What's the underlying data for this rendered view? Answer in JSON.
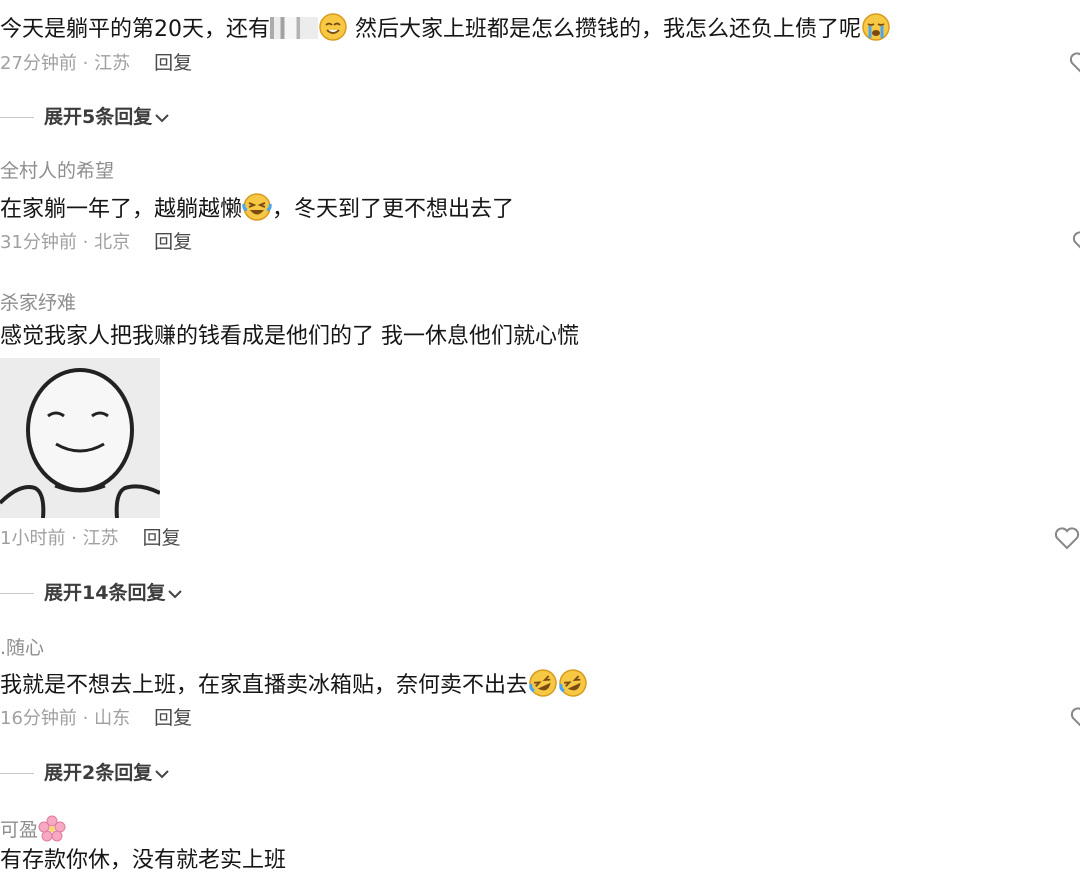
{
  "comments": [
    {
      "text_a": "今天是躺平的第20天，还有",
      "text_b": " 然后大家上班都是怎么攒钱的，我怎么还负上债了呢",
      "time": "27分钟前 · 江苏",
      "reply": "回复",
      "expand": "展开5条回复"
    },
    {
      "user": "全村人的希望",
      "text_a": "在家躺一年了，越躺越懒",
      "text_b": "，冬天到了更不想出去了",
      "time": "31分钟前 · 北京",
      "reply": "回复"
    },
    {
      "user": "杀家纾难",
      "text": "感觉我家人把我赚的钱看成是他们的了   我一休息他们就心慌",
      "time": "1小时前 · 江苏",
      "reply": "回复",
      "expand": "展开14条回复"
    },
    {
      "user": ".随心",
      "text": "我就是不想去上班，在家直播卖冰箱贴，奈何卖不出去",
      "time": "16分钟前 · 山东",
      "reply": "回复",
      "expand": "展开2条回复"
    },
    {
      "user": "可盈",
      "text": "有存款你休，没有就老实上班"
    }
  ],
  "icons": {
    "like": "heart-icon",
    "expand": "chevron-down-icon",
    "emoji_smile": "smile-emoji",
    "emoji_cry": "crying-emoji",
    "emoji_laugh": "laughing-tears-emoji",
    "emoji_rofl": "rofl-emoji",
    "emoji_blossom": "cherry-blossom-emoji"
  },
  "colors": {
    "meta": "#a0a0a0",
    "name": "#8e8e8e",
    "text": "#161616"
  }
}
